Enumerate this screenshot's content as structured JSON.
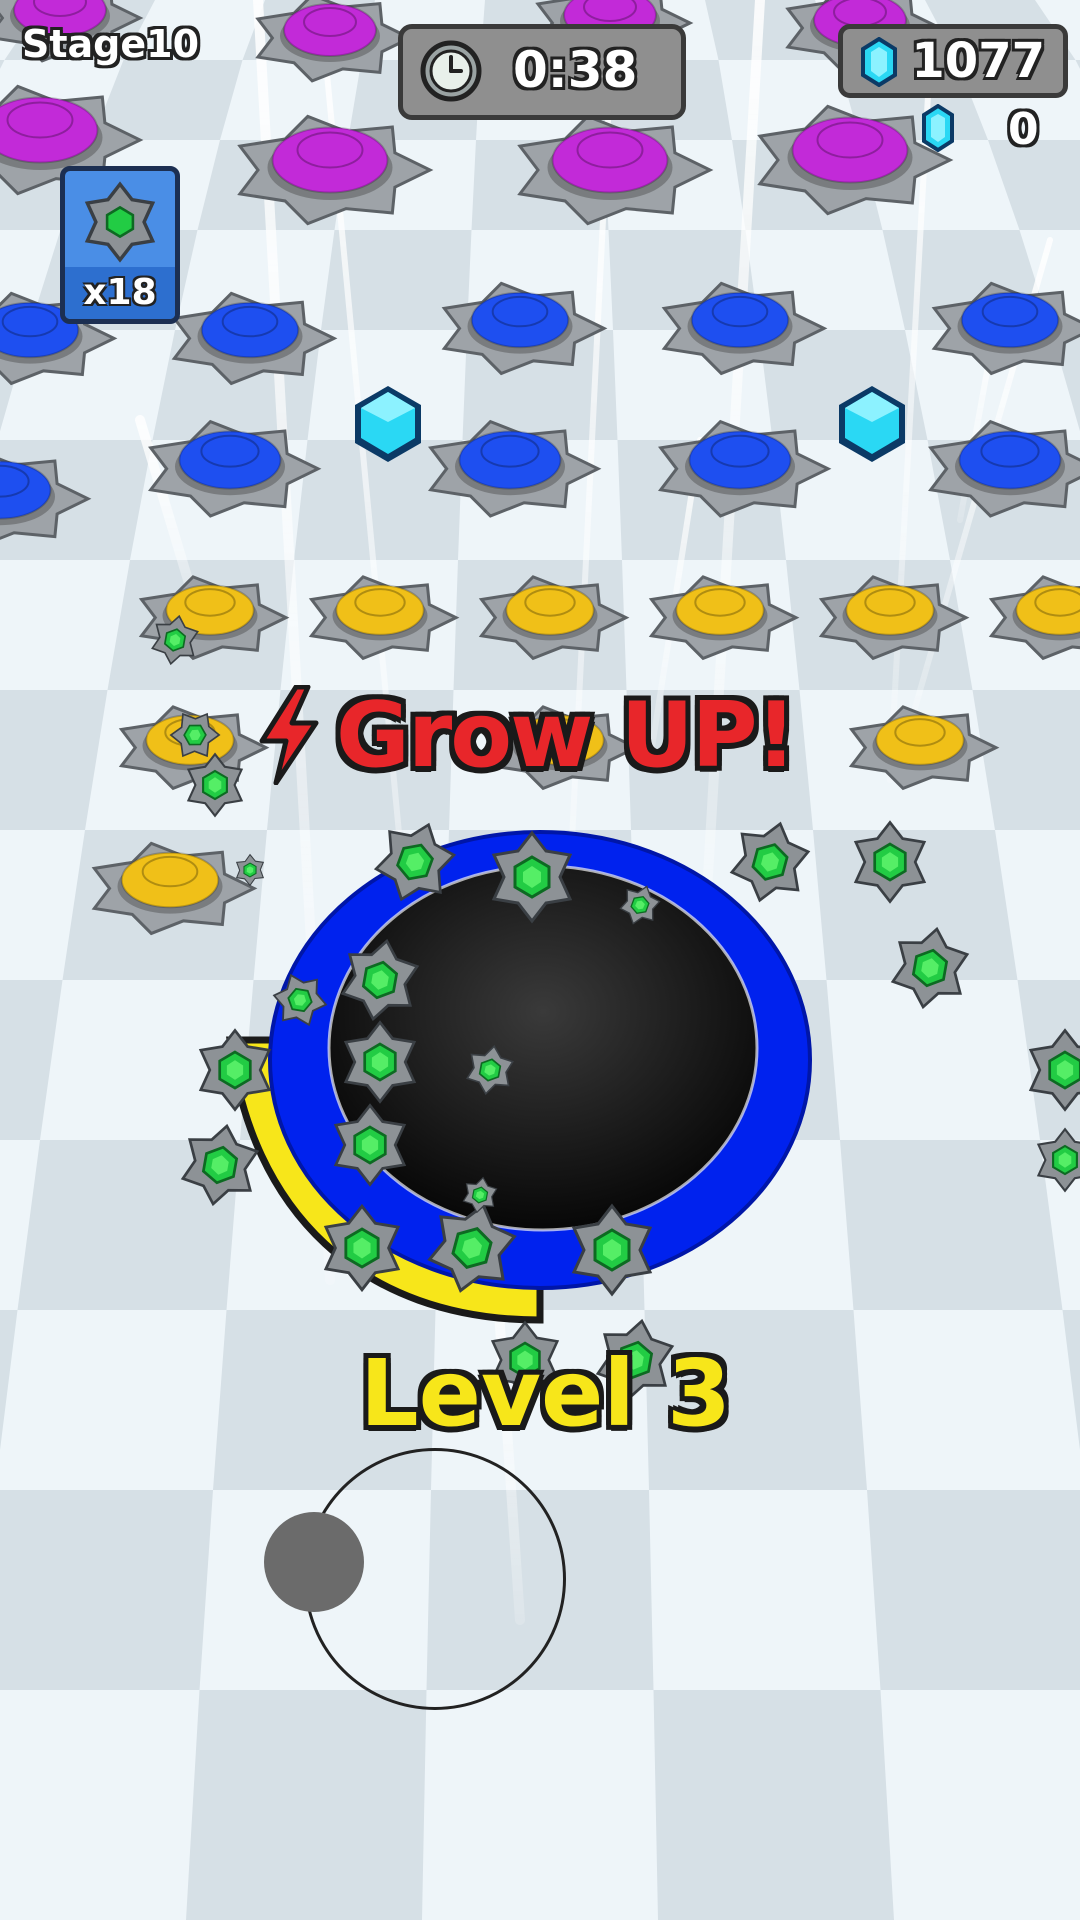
{
  "hud": {
    "stage_label": "Stage10",
    "timer": "0:38",
    "gem_total": "1077",
    "gem_collected": "0",
    "inventory_count": "x18"
  },
  "banner": {
    "grow_text": "Grow UP!"
  },
  "player": {
    "level_text": "Level 3",
    "hole_color": "#0022ee",
    "progress_color": "#f7e61a"
  },
  "colors": {
    "purple_target": "#c22ad8",
    "blue_target": "#1e4ff0",
    "yellow_target": "#f0c018",
    "green_spinner": "#22cc44",
    "gem": "#2ad8f4"
  },
  "icons": {
    "timer": "clock-icon",
    "gem": "gem-icon",
    "inventory": "spinner-icon",
    "banner": "lightning-bolt-icon"
  }
}
